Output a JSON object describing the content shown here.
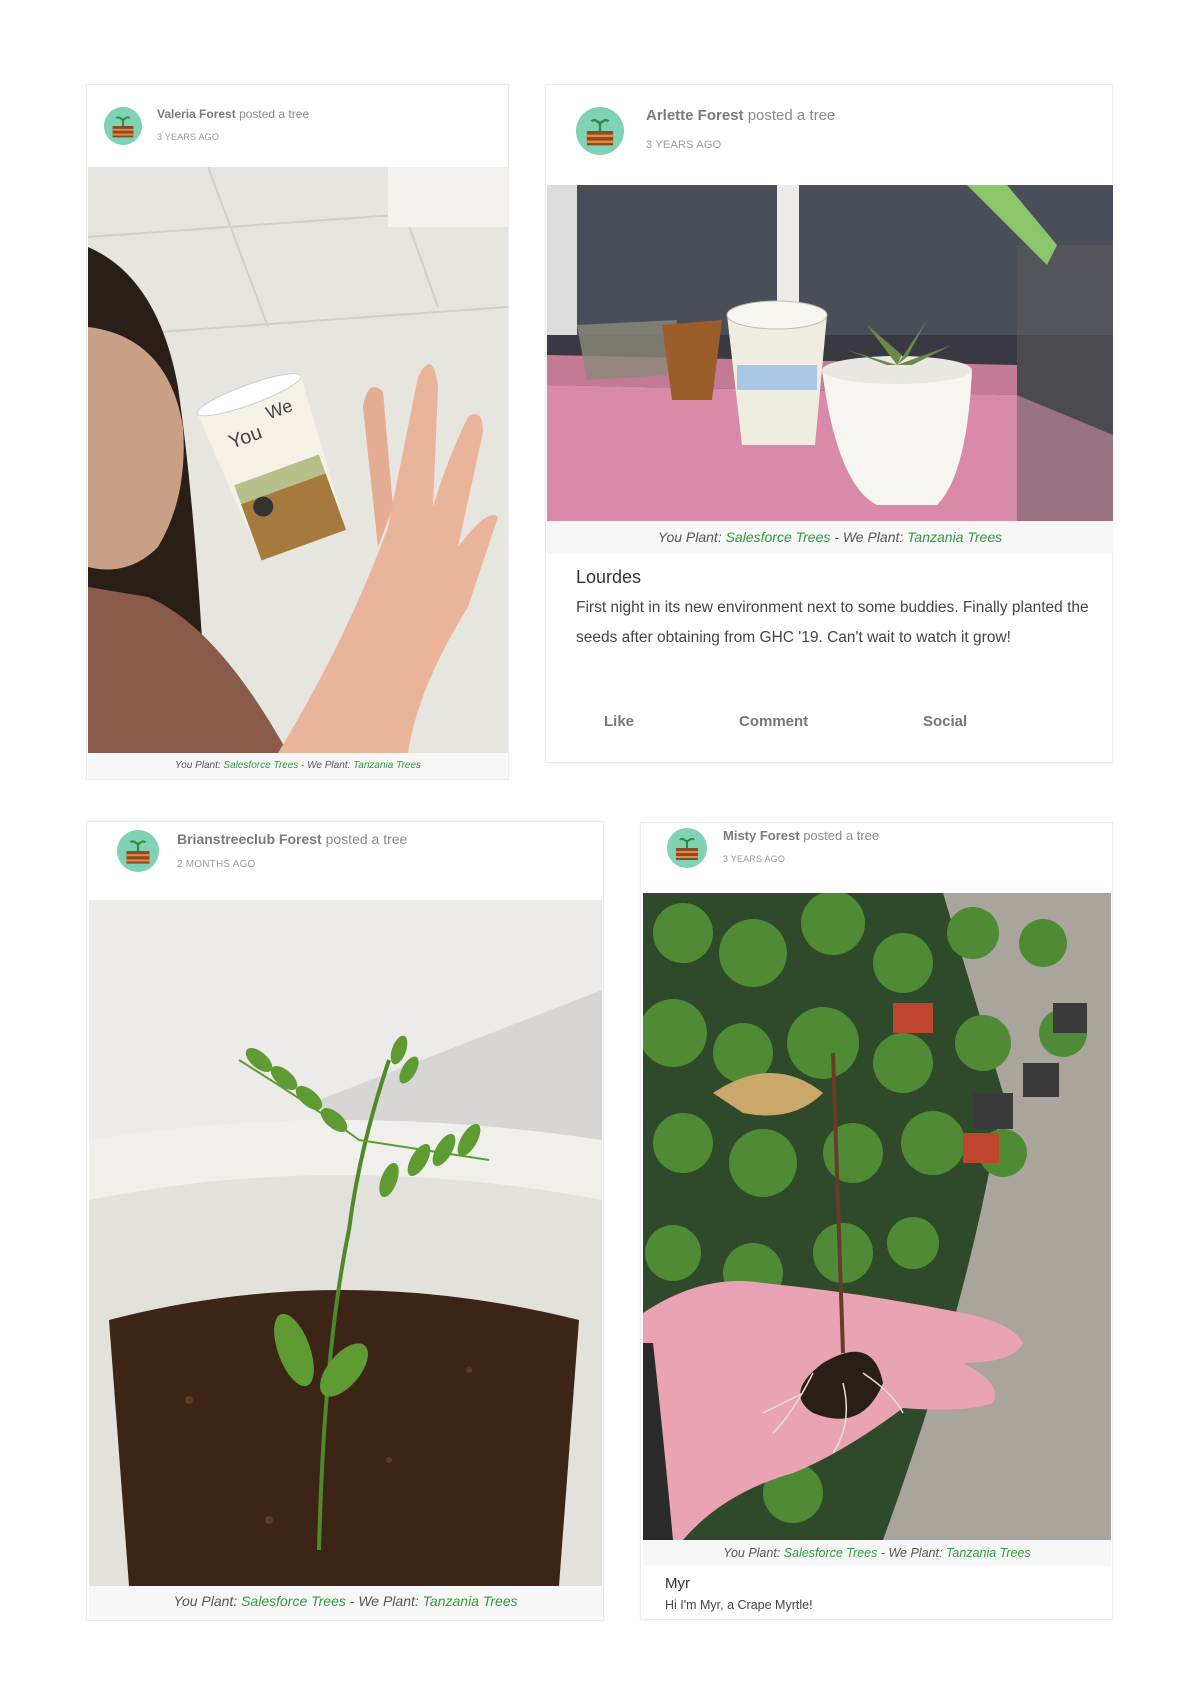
{
  "posts": [
    {
      "author": "Valeria Forest",
      "action": "posted a tree",
      "time": "3 YEARS AGO",
      "photo_alt": "woman holding a tree cup",
      "caption": {
        "you_plant": "You Plant:",
        "you_link": "Salesforce Trees",
        "sep": " - We Plant:",
        "we_link": "Tanzania Trees"
      }
    },
    {
      "author": "Arlette Forest",
      "action": "posted a tree",
      "time": "3 YEARS AGO",
      "photo_alt": "plants on a windowsill",
      "caption": {
        "you_plant": "You Plant:",
        "you_link": "Salesforce Trees",
        "sep": " - We Plant:",
        "we_link": "Tanzania Trees"
      },
      "title": "Lourdes",
      "text": "First night in its new environment next to some buddies. Finally planted the seeds after obtaining from GHC '19. Can't wait to watch it grow!",
      "actions": {
        "like": "Like",
        "comment": "Comment",
        "social": "Social"
      }
    },
    {
      "author": "Brianstreeclub Forest",
      "action": "posted a tree",
      "time": "2 MONTHS AGO",
      "photo_alt": "seedling in a pot",
      "caption": {
        "you_plant": "You Plant:",
        "you_link": "Salesforce Trees",
        "sep": " - We Plant:",
        "we_link": "Tanzania Trees"
      }
    },
    {
      "author": "Misty Forest",
      "action": "posted a tree",
      "time": "3 YEARS AGO",
      "photo_alt": "hand holding a crape myrtle seedling",
      "caption": {
        "you_plant": "You Plant:",
        "you_link": "Salesforce Trees",
        "sep": " - We Plant:",
        "we_link": "Tanzania Trees"
      },
      "title": "Myr",
      "text": "Hi I'm Myr, a Crape Myrtle!"
    }
  ],
  "colors": {
    "link": "#2f9a3f",
    "avatar": "#7fd3b4"
  },
  "icons": {
    "avatar": "tree-avatar-icon"
  }
}
